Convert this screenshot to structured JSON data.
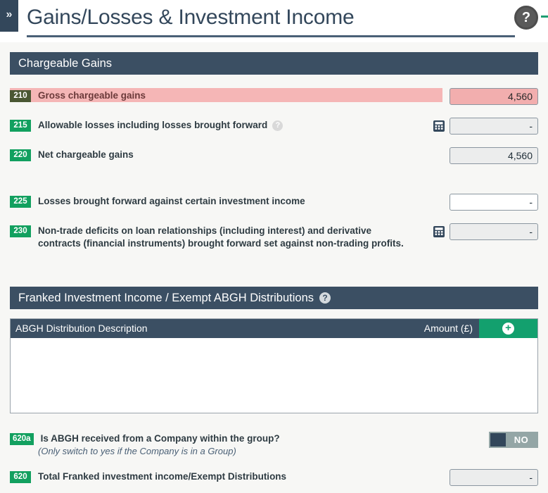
{
  "window": {
    "collapse_tab_icon": "chevron-double-right-icon"
  },
  "header": {
    "title": "Gains/Losses & Investment Income",
    "help_icon": "help-circle-icon",
    "help_glyph": "?"
  },
  "sections": [
    {
      "id": "chargeable-gains",
      "title": "Chargeable Gains",
      "has_help": false
    },
    {
      "id": "franked-investment-income",
      "title": "Franked Investment Income / Exempt ABGH Distributions",
      "has_help": true,
      "help_glyph": "?"
    }
  ],
  "rows": {
    "r210": {
      "box": "210",
      "label": "Gross chargeable gains",
      "value": "4,560",
      "state": "error"
    },
    "r215": {
      "box": "215",
      "label": "Allowable losses including losses brought forward",
      "value": "-",
      "help_glyph": "?",
      "calc_icon": "calculator-icon"
    },
    "r220": {
      "box": "220",
      "label": "Net chargeable gains",
      "value": "4,560"
    },
    "r225": {
      "box": "225",
      "label": "Losses brought forward against certain investment income",
      "value": "-"
    },
    "r230": {
      "box": "230",
      "label": "Non-trade deficits on loan relationships (including interest) and derivative contracts (financial instruments) brought forward set against non-trading profits.",
      "value": "-",
      "calc_icon": "calculator-icon"
    },
    "r620a": {
      "box": "620a",
      "label": "Is ABGH received from a Company within the group?",
      "hint": "(Only switch to yes if the Company is in a Group)",
      "toggle_value": "NO"
    },
    "r620": {
      "box": "620",
      "label": "Total Franked investment income/Exempt Distributions",
      "value": "-"
    }
  },
  "table": {
    "columns": {
      "description": "ABGH Distribution Description",
      "amount": "Amount (£)"
    },
    "add_button_glyph": "+",
    "add_button_icon": "plus-circle-icon",
    "rows": []
  },
  "colors": {
    "header_navy": "#3b4f63",
    "badge_green": "#12a05f",
    "error_pink": "#f5b6b6",
    "accent_green": "#13a06e",
    "page_bg": "#f7f7f5"
  }
}
